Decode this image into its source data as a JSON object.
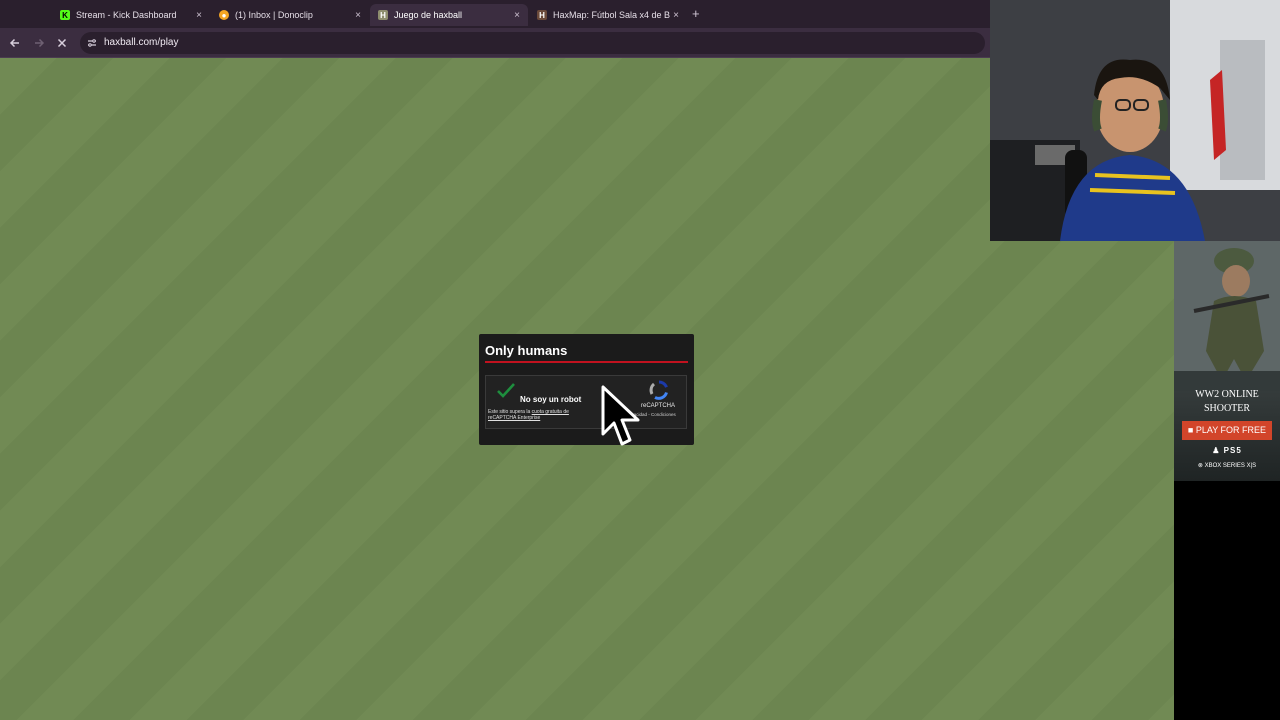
{
  "browser": {
    "tabs": [
      {
        "label": "Stream - Kick Dashboard",
        "favicon": "kick-icon",
        "active": false
      },
      {
        "label": "(1) Inbox | Donoclip",
        "favicon": "donoclip-icon",
        "active": false
      },
      {
        "label": "Juego de haxball",
        "favicon": "haxball-icon",
        "active": true
      },
      {
        "label": "HaxMap: Fútbol Sala x4 de B",
        "favicon": "haxmap-icon",
        "active": false
      }
    ],
    "new_tab": "+",
    "close_glyph": "×",
    "url": "haxball.com/play"
  },
  "modal": {
    "title": "Only humans",
    "recaptcha": {
      "checkbox_label": "No soy un robot",
      "notice_prefix": "Este sitio supera la",
      "notice_link": "cuota gratuita de reCAPTCHA Enterprise",
      "brand": "reCAPTCHA",
      "terms": "Privacidad - Condiciones"
    }
  },
  "ad": {
    "headline_1": "WW2 ONLINE",
    "headline_2": "SHOOTER",
    "button": "PLAY FOR FREE",
    "platform_1": "PS5",
    "platform_2": "XBOX SERIES X|S"
  },
  "colors": {
    "accent_red": "#c1121f",
    "field_green": "#718a54",
    "check_green": "#1e8e3e",
    "ad_button": "#d2452a"
  }
}
